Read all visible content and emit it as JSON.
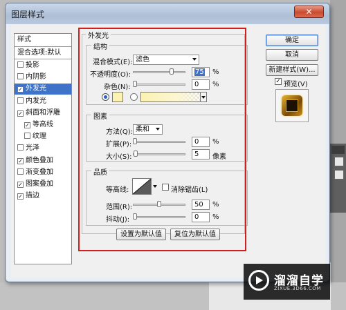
{
  "window": {
    "title": "图层样式",
    "close_symbol": "✕"
  },
  "style_list": {
    "header": "样式",
    "blend_options": "混合选项:默认",
    "items": [
      {
        "label": "投影",
        "checked": false
      },
      {
        "label": "内阴影",
        "checked": false
      },
      {
        "label": "外发光",
        "checked": true,
        "selected": true
      },
      {
        "label": "内发光",
        "checked": false
      },
      {
        "label": "斜面和浮雕",
        "checked": true
      },
      {
        "label": "等高线",
        "checked": true,
        "indent": true
      },
      {
        "label": "纹理",
        "checked": false,
        "indent": true
      },
      {
        "label": "光泽",
        "checked": false
      },
      {
        "label": "颜色叠加",
        "checked": true
      },
      {
        "label": "渐变叠加",
        "checked": false
      },
      {
        "label": "图案叠加",
        "checked": true
      },
      {
        "label": "描边",
        "checked": true
      }
    ]
  },
  "outer_glow": {
    "title": "外发光",
    "structure": {
      "title": "结构",
      "blend_mode_label": "混合模式(E):",
      "blend_mode_value": "滤色",
      "opacity_label": "不透明度(O):",
      "opacity_value": "75",
      "opacity_unit": "%",
      "opacity_level": 0.75,
      "noise_label": "杂色(N):",
      "noise_value": "0",
      "noise_unit": "%",
      "noise_level": 0.0,
      "color_swatch": "#fbf2b3"
    },
    "elements": {
      "title": "图素",
      "method_label": "方法(Q):",
      "method_value": "柔和",
      "spread_label": "扩展(P):",
      "spread_value": "0",
      "spread_unit": "%",
      "spread_level": 0.0,
      "size_label": "大小(S):",
      "size_value": "5",
      "size_unit": "像素",
      "size_level": 0.02
    },
    "quality": {
      "title": "品质",
      "contour_label": "等高线:",
      "antialias_label": "消除锯齿(L)",
      "antialias_checked": false,
      "range_label": "范围(R):",
      "range_value": "50",
      "range_unit": "%",
      "range_level": 0.5,
      "jitter_label": "抖动(J):",
      "jitter_value": "0",
      "jitter_unit": "%",
      "jitter_level": 0.0
    },
    "set_default": "设置为默认值",
    "reset_default": "复位为默认值"
  },
  "buttons": {
    "ok": "确定",
    "cancel": "取消",
    "new_style": "新建样式(W)...",
    "preview_label": "预览(V)",
    "preview_checked": true
  },
  "watermark": {
    "name": "溜溜自学",
    "url": "ZIXUE.3D66.COM"
  },
  "colors": {
    "accent": "#3f73c9",
    "highlight_box": "#d11f1f"
  }
}
